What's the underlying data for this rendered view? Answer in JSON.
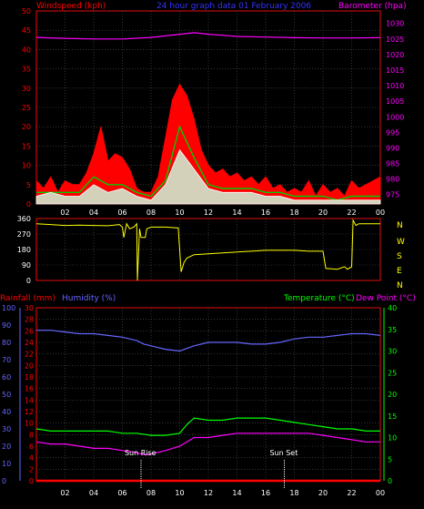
{
  "header": {
    "windspeed_label": "Windspeed (kph)",
    "title": "24 hour graph data  01 February 2006",
    "barometer_label": "Barometer (hpa)"
  },
  "compass": [
    "N",
    "W",
    "S",
    "E",
    "N"
  ],
  "middle_labels": {
    "rainfall": "Rainfall (mm)",
    "humidity": "Humidity (%)",
    "temperature": "Temperature (°C)",
    "dewpoint": "Dew Point (°C)"
  },
  "annotations": {
    "sunrise": "Sun Rise",
    "sunset": "Sun Set"
  },
  "colors": {
    "wind_gust": "#ff0000",
    "wind_avg": "#00cc00",
    "wind_speed": "#ffffff",
    "barometer": "#ff00ff",
    "direction": "#ffff00",
    "humidity": "#6666ff",
    "rainfall": "#ff0000",
    "temperature": "#00ff00",
    "dewpoint": "#ff00ff",
    "axis": "#ff0000",
    "grid": "#555555"
  },
  "chart_data": [
    {
      "type": "line",
      "name": "wind",
      "x_ticks": [
        "02",
        "04",
        "06",
        "08",
        "10",
        "12",
        "14",
        "16",
        "18",
        "20",
        "22",
        "00"
      ],
      "x_range": [
        0,
        24
      ],
      "ylim": [
        0,
        50
      ],
      "y_ticks": [
        0,
        5,
        10,
        15,
        20,
        25,
        30,
        35,
        40,
        45,
        50
      ],
      "y2lim": [
        972,
        1034
      ],
      "y2_ticks": [
        975,
        980,
        985,
        990,
        995,
        1000,
        1005,
        1010,
        1015,
        1020,
        1025,
        1030
      ],
      "series": [
        {
          "name": "Windspeed (kph)",
          "role": "gust",
          "x": [
            0,
            0.5,
            1,
            1.5,
            2,
            2.5,
            3,
            3.5,
            4,
            4.5,
            5,
            5.5,
            6,
            6.5,
            7,
            7.5,
            8,
            8.5,
            9,
            9.5,
            10,
            10.5,
            11,
            11.5,
            12,
            12.5,
            13,
            13.5,
            14,
            14.5,
            15,
            15.5,
            16,
            16.5,
            17,
            17.5,
            18,
            18.5,
            19,
            19.5,
            20,
            20.5,
            21,
            21.5,
            22,
            22.5,
            23,
            23.5,
            24
          ],
          "y": [
            6,
            4,
            7,
            3,
            6,
            5,
            5,
            8,
            13,
            20,
            11,
            13,
            12,
            9,
            4,
            3,
            3,
            7,
            17,
            27,
            31,
            28,
            22,
            14,
            10,
            8,
            9,
            7,
            8,
            6,
            7,
            5,
            7,
            4,
            5,
            3,
            4,
            3,
            6,
            2,
            5,
            3,
            4,
            2,
            6,
            4,
            5,
            6,
            7
          ]
        },
        {
          "name": "Average",
          "role": "average",
          "x": [
            0,
            1,
            2,
            3,
            4,
            5,
            6,
            7,
            8,
            9,
            10,
            11,
            12,
            13,
            14,
            15,
            16,
            17,
            18,
            19,
            20,
            21,
            22,
            23,
            24
          ],
          "y": [
            3,
            3,
            3,
            3,
            7,
            5,
            5,
            3,
            2,
            6,
            20,
            12,
            5,
            4,
            4,
            4,
            3,
            3,
            2,
            2,
            2,
            1,
            2,
            2,
            2
          ]
        },
        {
          "name": "Speed",
          "role": "speed",
          "x": [
            0,
            1,
            2,
            3,
            4,
            5,
            6,
            7,
            8,
            9,
            10,
            11,
            12,
            13,
            14,
            15,
            16,
            17,
            18,
            19,
            20,
            21,
            22,
            23,
            24
          ],
          "y": [
            2,
            3,
            2,
            2,
            5,
            3,
            4,
            2,
            1,
            5,
            14,
            9,
            4,
            3,
            3,
            3,
            2,
            2,
            1,
            1,
            1,
            1,
            1,
            1,
            1
          ]
        },
        {
          "name": "Barometer (hpa)",
          "role": "barometer",
          "axis": "right",
          "x": [
            0,
            2,
            4,
            6,
            8,
            10,
            11,
            12,
            14,
            16,
            18,
            20,
            22,
            24
          ],
          "y": [
            1025.5,
            1025.2,
            1025.0,
            1025.0,
            1025.5,
            1026.5,
            1027.0,
            1026.5,
            1025.8,
            1025.6,
            1025.4,
            1025.3,
            1025.3,
            1025.4
          ]
        }
      ]
    },
    {
      "type": "line",
      "name": "wind-direction",
      "ylim": [
        0,
        360
      ],
      "y_ticks": [
        0,
        90,
        180,
        270,
        360
      ],
      "series": [
        {
          "name": "Direction",
          "x": [
            0,
            1,
            2,
            3,
            4,
            5,
            5.8,
            6,
            6.1,
            6.3,
            6.5,
            6.8,
            7,
            7.05,
            7.2,
            7.3,
            7.6,
            7.7,
            8,
            9,
            9.9,
            10.1,
            10.3,
            10.5,
            11,
            12,
            13,
            14,
            15,
            16,
            17,
            18,
            19,
            20,
            20.2,
            21,
            21.5,
            21.7,
            22,
            22.1,
            22.3,
            22.5,
            23,
            24
          ],
          "y": [
            330,
            325,
            320,
            322,
            320,
            318,
            325,
            310,
            250,
            330,
            300,
            310,
            330,
            0,
            300,
            250,
            250,
            300,
            310,
            310,
            305,
            50,
            105,
            130,
            150,
            155,
            160,
            165,
            170,
            175,
            175,
            175,
            170,
            170,
            70,
            65,
            80,
            65,
            80,
            350,
            320,
            330,
            330,
            330
          ]
        }
      ]
    },
    {
      "type": "line",
      "name": "humidity-temperature",
      "x_ticks": [
        "02",
        "04",
        "06",
        "08",
        "10",
        "12",
        "14",
        "16",
        "18",
        "20",
        "22",
        "00"
      ],
      "x_range": [
        0,
        24
      ],
      "humidity_ylim": [
        0,
        100
      ],
      "humidity_ticks": [
        0,
        10,
        20,
        30,
        40,
        50,
        60,
        70,
        80,
        90,
        100
      ],
      "rain_ylim": [
        0,
        30
      ],
      "rain_ticks": [
        0,
        2,
        4,
        6,
        8,
        10,
        12,
        14,
        16,
        18,
        20,
        22,
        24,
        26,
        28,
        30
      ],
      "temp_ylim": [
        0,
        40
      ],
      "temp_ticks": [
        0,
        5,
        10,
        15,
        20,
        25,
        30,
        35,
        40
      ],
      "sunrise_hour": 7.3,
      "sunset_hour": 17.3,
      "series": [
        {
          "name": "Humidity (%)",
          "axis": "humidity",
          "x": [
            0,
            1,
            2,
            3,
            4,
            5,
            6,
            7,
            7.5,
            8,
            9,
            10,
            11,
            12,
            13,
            14,
            15,
            16,
            17,
            18,
            19,
            20,
            21,
            22,
            23,
            24
          ],
          "y": [
            87,
            87,
            86,
            85,
            85,
            84,
            83,
            81,
            79,
            78,
            76,
            75,
            78,
            80,
            80,
            80,
            79,
            79,
            80,
            82,
            83,
            83,
            84,
            85,
            85,
            84
          ]
        },
        {
          "name": "Rainfall (mm)",
          "axis": "rain",
          "x": [
            0,
            24
          ],
          "y": [
            0,
            0
          ]
        },
        {
          "name": "Temperature (°C)",
          "axis": "temp",
          "x": [
            0,
            1,
            2,
            3,
            4,
            5,
            6,
            7,
            8,
            9,
            10,
            10.5,
            11,
            12,
            13,
            14,
            15,
            16,
            17,
            18,
            19,
            20,
            21,
            22,
            23,
            24
          ],
          "y": [
            12,
            11.5,
            11.5,
            11.5,
            11.5,
            11.5,
            11,
            11,
            10.5,
            10.5,
            11,
            13,
            14.5,
            14,
            14,
            14.5,
            14.5,
            14.5,
            14,
            13.5,
            13,
            12.5,
            12,
            12,
            11.5,
            11.5
          ]
        },
        {
          "name": "Dew Point (°C)",
          "axis": "temp",
          "x": [
            0,
            1,
            2,
            3,
            4,
            5,
            6,
            7,
            7.5,
            8,
            9,
            10,
            11,
            12,
            13,
            14,
            15,
            16,
            17,
            18,
            19,
            20,
            21,
            22,
            23,
            24
          ],
          "y": [
            9,
            8.5,
            8.5,
            8,
            7.5,
            7.5,
            7,
            6.5,
            6,
            6.2,
            7,
            8,
            10,
            10,
            10.5,
            11,
            11,
            11,
            11,
            11,
            11,
            10.5,
            10,
            9.5,
            9,
            9
          ]
        }
      ]
    }
  ]
}
